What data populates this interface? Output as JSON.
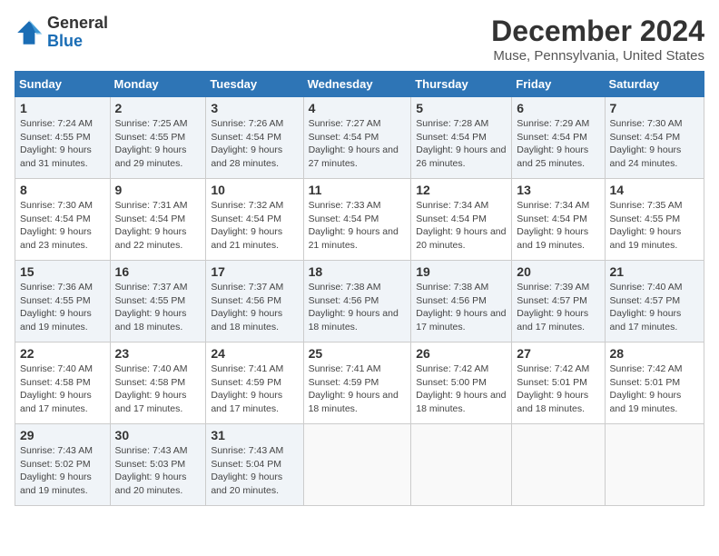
{
  "logo": {
    "line1": "General",
    "line2": "Blue"
  },
  "title": "December 2024",
  "location": "Muse, Pennsylvania, United States",
  "days_of_week": [
    "Sunday",
    "Monday",
    "Tuesday",
    "Wednesday",
    "Thursday",
    "Friday",
    "Saturday"
  ],
  "weeks": [
    [
      {
        "day": "1",
        "sunrise": "Sunrise: 7:24 AM",
        "sunset": "Sunset: 4:55 PM",
        "daylight": "Daylight: 9 hours and 31 minutes."
      },
      {
        "day": "2",
        "sunrise": "Sunrise: 7:25 AM",
        "sunset": "Sunset: 4:55 PM",
        "daylight": "Daylight: 9 hours and 29 minutes."
      },
      {
        "day": "3",
        "sunrise": "Sunrise: 7:26 AM",
        "sunset": "Sunset: 4:54 PM",
        "daylight": "Daylight: 9 hours and 28 minutes."
      },
      {
        "day": "4",
        "sunrise": "Sunrise: 7:27 AM",
        "sunset": "Sunset: 4:54 PM",
        "daylight": "Daylight: 9 hours and 27 minutes."
      },
      {
        "day": "5",
        "sunrise": "Sunrise: 7:28 AM",
        "sunset": "Sunset: 4:54 PM",
        "daylight": "Daylight: 9 hours and 26 minutes."
      },
      {
        "day": "6",
        "sunrise": "Sunrise: 7:29 AM",
        "sunset": "Sunset: 4:54 PM",
        "daylight": "Daylight: 9 hours and 25 minutes."
      },
      {
        "day": "7",
        "sunrise": "Sunrise: 7:30 AM",
        "sunset": "Sunset: 4:54 PM",
        "daylight": "Daylight: 9 hours and 24 minutes."
      }
    ],
    [
      {
        "day": "8",
        "sunrise": "Sunrise: 7:30 AM",
        "sunset": "Sunset: 4:54 PM",
        "daylight": "Daylight: 9 hours and 23 minutes."
      },
      {
        "day": "9",
        "sunrise": "Sunrise: 7:31 AM",
        "sunset": "Sunset: 4:54 PM",
        "daylight": "Daylight: 9 hours and 22 minutes."
      },
      {
        "day": "10",
        "sunrise": "Sunrise: 7:32 AM",
        "sunset": "Sunset: 4:54 PM",
        "daylight": "Daylight: 9 hours and 21 minutes."
      },
      {
        "day": "11",
        "sunrise": "Sunrise: 7:33 AM",
        "sunset": "Sunset: 4:54 PM",
        "daylight": "Daylight: 9 hours and 21 minutes."
      },
      {
        "day": "12",
        "sunrise": "Sunrise: 7:34 AM",
        "sunset": "Sunset: 4:54 PM",
        "daylight": "Daylight: 9 hours and 20 minutes."
      },
      {
        "day": "13",
        "sunrise": "Sunrise: 7:34 AM",
        "sunset": "Sunset: 4:54 PM",
        "daylight": "Daylight: 9 hours and 19 minutes."
      },
      {
        "day": "14",
        "sunrise": "Sunrise: 7:35 AM",
        "sunset": "Sunset: 4:55 PM",
        "daylight": "Daylight: 9 hours and 19 minutes."
      }
    ],
    [
      {
        "day": "15",
        "sunrise": "Sunrise: 7:36 AM",
        "sunset": "Sunset: 4:55 PM",
        "daylight": "Daylight: 9 hours and 19 minutes."
      },
      {
        "day": "16",
        "sunrise": "Sunrise: 7:37 AM",
        "sunset": "Sunset: 4:55 PM",
        "daylight": "Daylight: 9 hours and 18 minutes."
      },
      {
        "day": "17",
        "sunrise": "Sunrise: 7:37 AM",
        "sunset": "Sunset: 4:56 PM",
        "daylight": "Daylight: 9 hours and 18 minutes."
      },
      {
        "day": "18",
        "sunrise": "Sunrise: 7:38 AM",
        "sunset": "Sunset: 4:56 PM",
        "daylight": "Daylight: 9 hours and 18 minutes."
      },
      {
        "day": "19",
        "sunrise": "Sunrise: 7:38 AM",
        "sunset": "Sunset: 4:56 PM",
        "daylight": "Daylight: 9 hours and 17 minutes."
      },
      {
        "day": "20",
        "sunrise": "Sunrise: 7:39 AM",
        "sunset": "Sunset: 4:57 PM",
        "daylight": "Daylight: 9 hours and 17 minutes."
      },
      {
        "day": "21",
        "sunrise": "Sunrise: 7:40 AM",
        "sunset": "Sunset: 4:57 PM",
        "daylight": "Daylight: 9 hours and 17 minutes."
      }
    ],
    [
      {
        "day": "22",
        "sunrise": "Sunrise: 7:40 AM",
        "sunset": "Sunset: 4:58 PM",
        "daylight": "Daylight: 9 hours and 17 minutes."
      },
      {
        "day": "23",
        "sunrise": "Sunrise: 7:40 AM",
        "sunset": "Sunset: 4:58 PM",
        "daylight": "Daylight: 9 hours and 17 minutes."
      },
      {
        "day": "24",
        "sunrise": "Sunrise: 7:41 AM",
        "sunset": "Sunset: 4:59 PM",
        "daylight": "Daylight: 9 hours and 17 minutes."
      },
      {
        "day": "25",
        "sunrise": "Sunrise: 7:41 AM",
        "sunset": "Sunset: 4:59 PM",
        "daylight": "Daylight: 9 hours and 18 minutes."
      },
      {
        "day": "26",
        "sunrise": "Sunrise: 7:42 AM",
        "sunset": "Sunset: 5:00 PM",
        "daylight": "Daylight: 9 hours and 18 minutes."
      },
      {
        "day": "27",
        "sunrise": "Sunrise: 7:42 AM",
        "sunset": "Sunset: 5:01 PM",
        "daylight": "Daylight: 9 hours and 18 minutes."
      },
      {
        "day": "28",
        "sunrise": "Sunrise: 7:42 AM",
        "sunset": "Sunset: 5:01 PM",
        "daylight": "Daylight: 9 hours and 19 minutes."
      }
    ],
    [
      {
        "day": "29",
        "sunrise": "Sunrise: 7:43 AM",
        "sunset": "Sunset: 5:02 PM",
        "daylight": "Daylight: 9 hours and 19 minutes."
      },
      {
        "day": "30",
        "sunrise": "Sunrise: 7:43 AM",
        "sunset": "Sunset: 5:03 PM",
        "daylight": "Daylight: 9 hours and 20 minutes."
      },
      {
        "day": "31",
        "sunrise": "Sunrise: 7:43 AM",
        "sunset": "Sunset: 5:04 PM",
        "daylight": "Daylight: 9 hours and 20 minutes."
      },
      null,
      null,
      null,
      null
    ]
  ]
}
